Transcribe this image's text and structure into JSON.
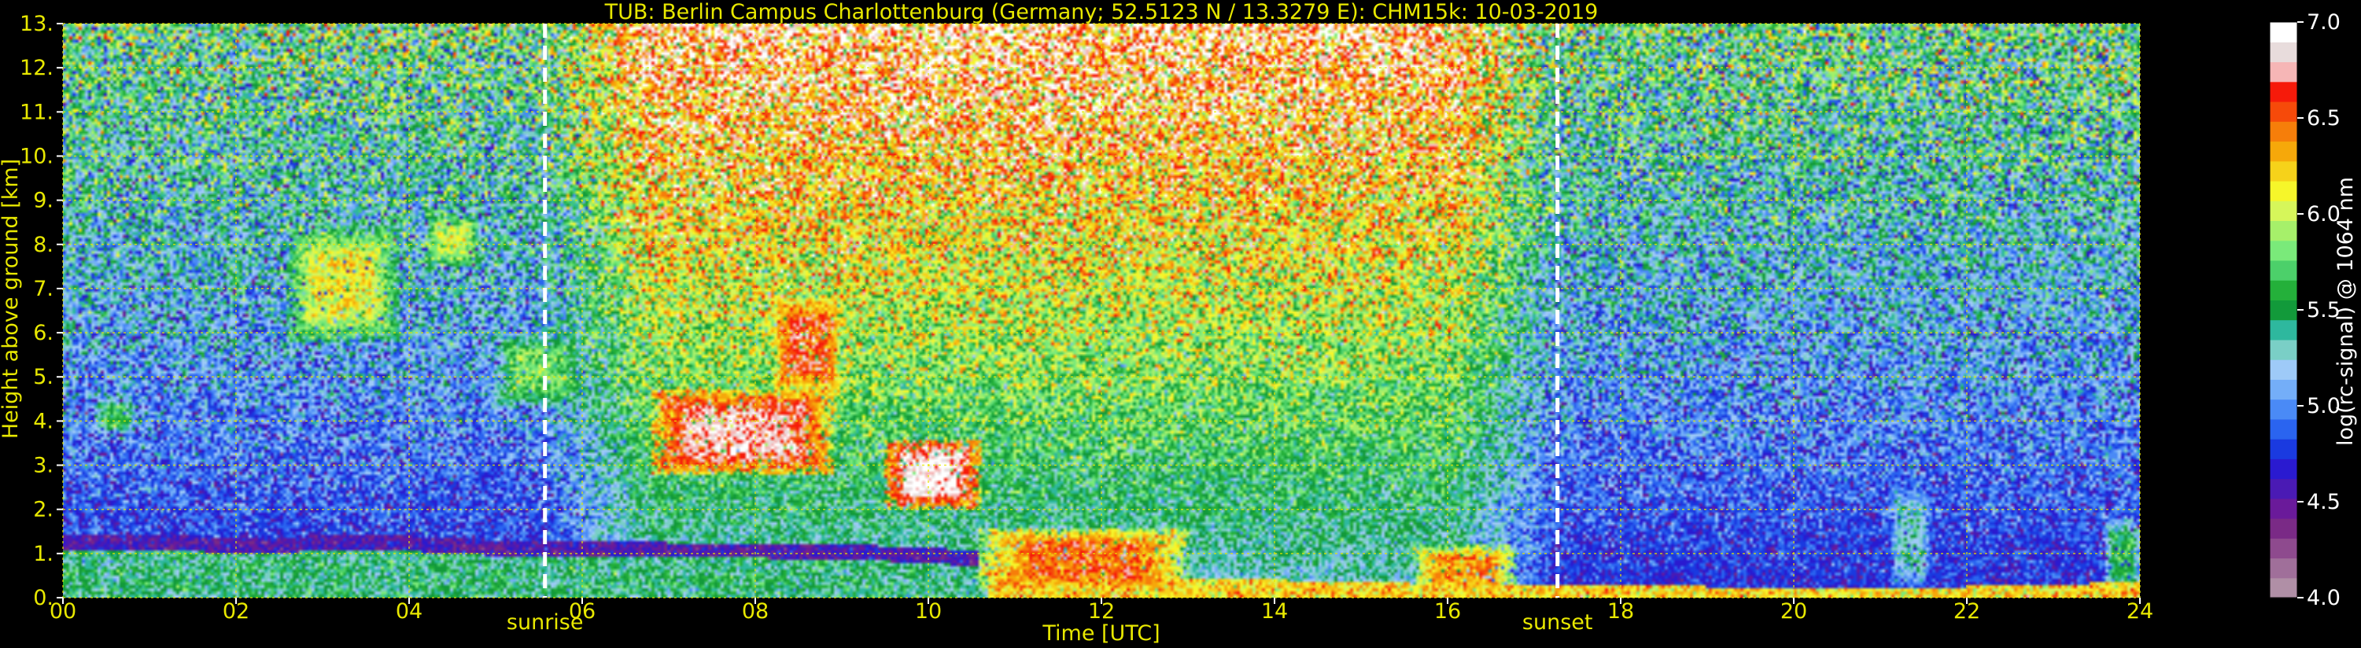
{
  "chart_data": {
    "type": "heatmap",
    "title": "TUB: Berlin Campus Charlottenburg (Germany; 52.5123 N / 13.3279 E):    CHM15k: 10-03-2019",
    "xlabel": "Time [UTC]",
    "ylabel": "Height above ground [km]",
    "xlim": [
      0,
      24
    ],
    "ylim": [
      0,
      13
    ],
    "x_ticks": [
      "00",
      "02",
      "04",
      "06",
      "08",
      "10",
      "12",
      "14",
      "16",
      "18",
      "20",
      "22",
      "24"
    ],
    "x_tick_values": [
      0,
      2,
      4,
      6,
      8,
      10,
      12,
      14,
      16,
      18,
      20,
      22,
      24
    ],
    "y_ticks": [
      "0.",
      "1.",
      "2.",
      "3.",
      "4.",
      "5.",
      "6.",
      "7.",
      "8.",
      "9.",
      "10.",
      "11.",
      "12.",
      "13."
    ],
    "y_tick_values": [
      0,
      1,
      2,
      3,
      4,
      5,
      6,
      7,
      8,
      9,
      10,
      11,
      12,
      13
    ],
    "grid": true,
    "colorbar": {
      "label": "log(rc-signal) @ 1064 nm",
      "range": [
        4.0,
        7.0
      ],
      "tick_values": [
        4.0,
        4.5,
        5.0,
        5.5,
        6.0,
        6.5,
        7.0
      ],
      "ticks": [
        "4.0",
        "4.5",
        "5.0",
        "5.5",
        "6.0",
        "6.5",
        "7.0"
      ],
      "colors": [
        "#b08fa6",
        "#a06f9a",
        "#8e4a8e",
        "#7a2a86",
        "#6a1a9a",
        "#4a1ab4",
        "#2a1ad0",
        "#1a3ae0",
        "#2a64f0",
        "#4a8af6",
        "#74aef8",
        "#9ecaf8",
        "#7acfc6",
        "#2eb89e",
        "#129a3a",
        "#24b03a",
        "#4cd06a",
        "#7aea7a",
        "#a6f06a",
        "#d6f65a",
        "#f6f62a",
        "#f6d21a",
        "#f6a80a",
        "#f67e0a",
        "#f64a0a",
        "#f61a0a",
        "#f6b6b6",
        "#e8dcdc",
        "#ffffff"
      ]
    },
    "annotations": [
      {
        "label": "sunrise",
        "x": 5.57
      },
      {
        "label": "sunset",
        "x": 17.27
      }
    ],
    "features": {
      "boundary_layer_top_km": [
        [
          0,
          1.05
        ],
        [
          1,
          1.1
        ],
        [
          2,
          1.0
        ],
        [
          3,
          1.05
        ],
        [
          4,
          1.05
        ],
        [
          5,
          0.95
        ],
        [
          6,
          0.95
        ],
        [
          7,
          0.9
        ],
        [
          8,
          0.9
        ],
        [
          9,
          0.85
        ],
        [
          10,
          0.8
        ],
        [
          11,
          0.6
        ],
        [
          12,
          0.5
        ],
        [
          13,
          0.45
        ],
        [
          14,
          0.4
        ],
        [
          15,
          0.35
        ],
        [
          16,
          0.3
        ],
        [
          17,
          0.3
        ],
        [
          18,
          0.3
        ],
        [
          19,
          0.25
        ],
        [
          20,
          0.25
        ],
        [
          21,
          0.25
        ],
        [
          22,
          0.25
        ],
        [
          23,
          0.3
        ],
        [
          24,
          0.35
        ]
      ],
      "cloud_layers": [
        {
          "start": 0.35,
          "end": 0.85,
          "base_km": 3.7,
          "top_km": 4.5,
          "log_signal": 5.6
        },
        {
          "start": 1.9,
          "end": 2.1,
          "base_km": 6.9,
          "top_km": 7.8,
          "log_signal": 5.5
        },
        {
          "start": 2.6,
          "end": 3.9,
          "base_km": 5.8,
          "top_km": 8.4,
          "log_signal": 6.1
        },
        {
          "start": 4.2,
          "end": 4.8,
          "base_km": 7.5,
          "top_km": 8.7,
          "log_signal": 6.0
        },
        {
          "start": 5.0,
          "end": 6.0,
          "base_km": 4.3,
          "top_km": 6.0,
          "log_signal": 5.8
        },
        {
          "start": 6.8,
          "end": 8.9,
          "base_km": 2.8,
          "top_km": 4.7,
          "log_signal": 6.8
        },
        {
          "start": 8.2,
          "end": 9.0,
          "base_km": 4.6,
          "top_km": 6.8,
          "log_signal": 6.6
        },
        {
          "start": 9.5,
          "end": 10.6,
          "base_km": 2.0,
          "top_km": 3.6,
          "log_signal": 6.9
        },
        {
          "start": 10.6,
          "end": 13.0,
          "base_km": 0.1,
          "top_km": 1.6,
          "log_signal": 6.5
        },
        {
          "start": 15.6,
          "end": 16.8,
          "base_km": 0.1,
          "top_km": 1.2,
          "log_signal": 6.4
        },
        {
          "start": 21.1,
          "end": 21.6,
          "base_km": 0.1,
          "top_km": 2.6,
          "log_signal": 5.3
        },
        {
          "start": 23.6,
          "end": 24.0,
          "base_km": 0.1,
          "top_km": 1.8,
          "log_signal": 5.6
        }
      ]
    }
  }
}
